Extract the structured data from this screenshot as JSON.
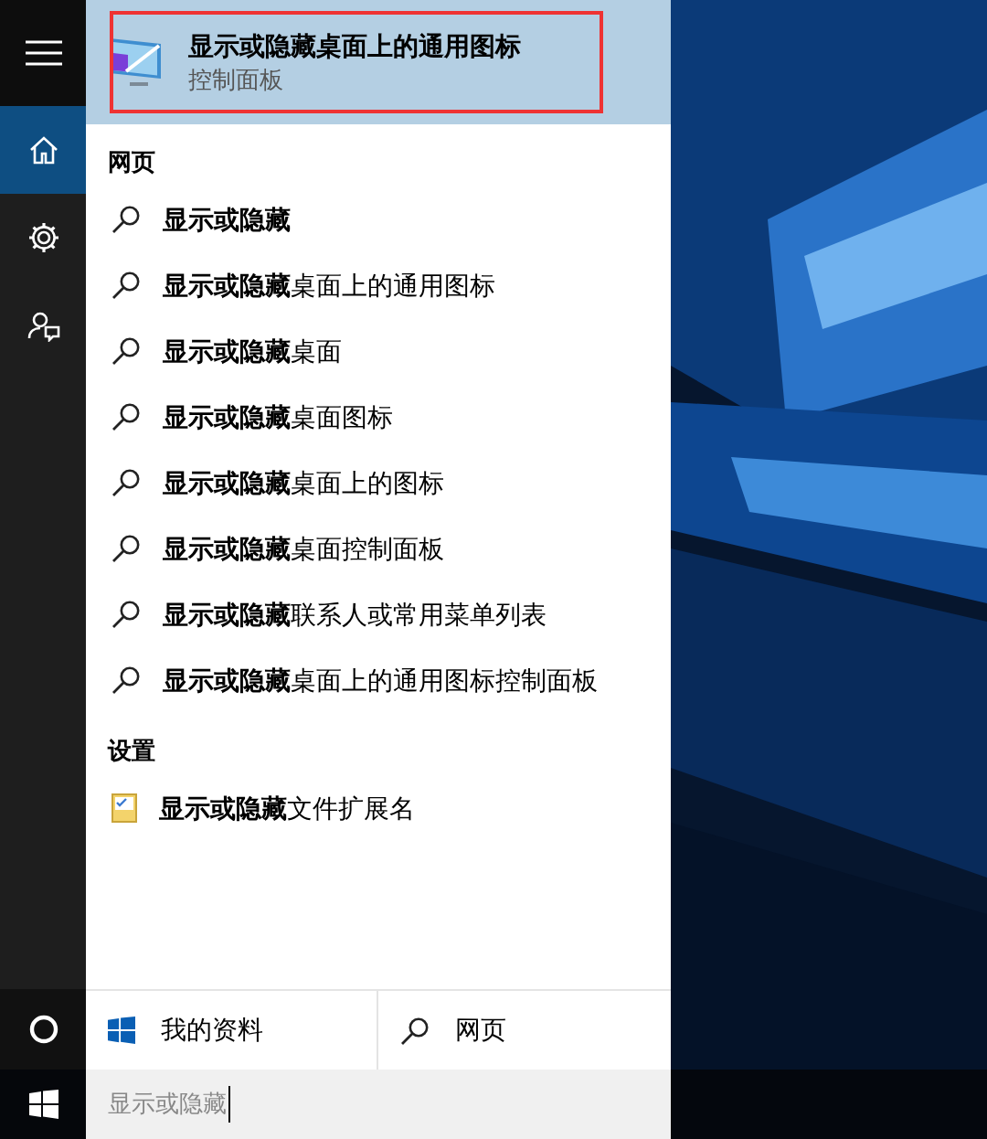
{
  "sidebar": {
    "items": [
      {
        "kind": "menu",
        "selected": false
      },
      {
        "kind": "home",
        "selected": true
      },
      {
        "kind": "settings",
        "selected": false
      },
      {
        "kind": "feedback",
        "selected": false
      }
    ]
  },
  "best_match": {
    "title": "显示或隐藏桌面上的通用图标",
    "subtitle": "控制面板",
    "selected": true,
    "annotated": true
  },
  "sections": [
    {
      "heading": "网页",
      "items": [
        {
          "kind": "web",
          "text": "**显示或隐藏**"
        },
        {
          "kind": "web",
          "text": "**显示或隐藏**桌面上的通用图标"
        },
        {
          "kind": "web",
          "text": "**显示或隐藏**桌面"
        },
        {
          "kind": "web",
          "text": "**显示或隐藏**桌面图标"
        },
        {
          "kind": "web",
          "text": "**显示或隐藏**桌面上的图标"
        },
        {
          "kind": "web",
          "text": "**显示或隐藏**桌面控制面板"
        },
        {
          "kind": "web",
          "text": "**显示或隐藏**联系人或常用菜单列表"
        },
        {
          "kind": "web",
          "text": "**显示或隐藏**桌面上的通用图标控制面板"
        }
      ]
    },
    {
      "heading": "设置",
      "items": [
        {
          "kind": "setting",
          "text": "**显示或隐藏**文件扩展名"
        }
      ]
    }
  ],
  "scope_buttons": [
    {
      "kind": "windows",
      "label": "我的资料"
    },
    {
      "kind": "search",
      "label": "网页"
    }
  ],
  "search_box": {
    "value": "显示或隐藏"
  }
}
